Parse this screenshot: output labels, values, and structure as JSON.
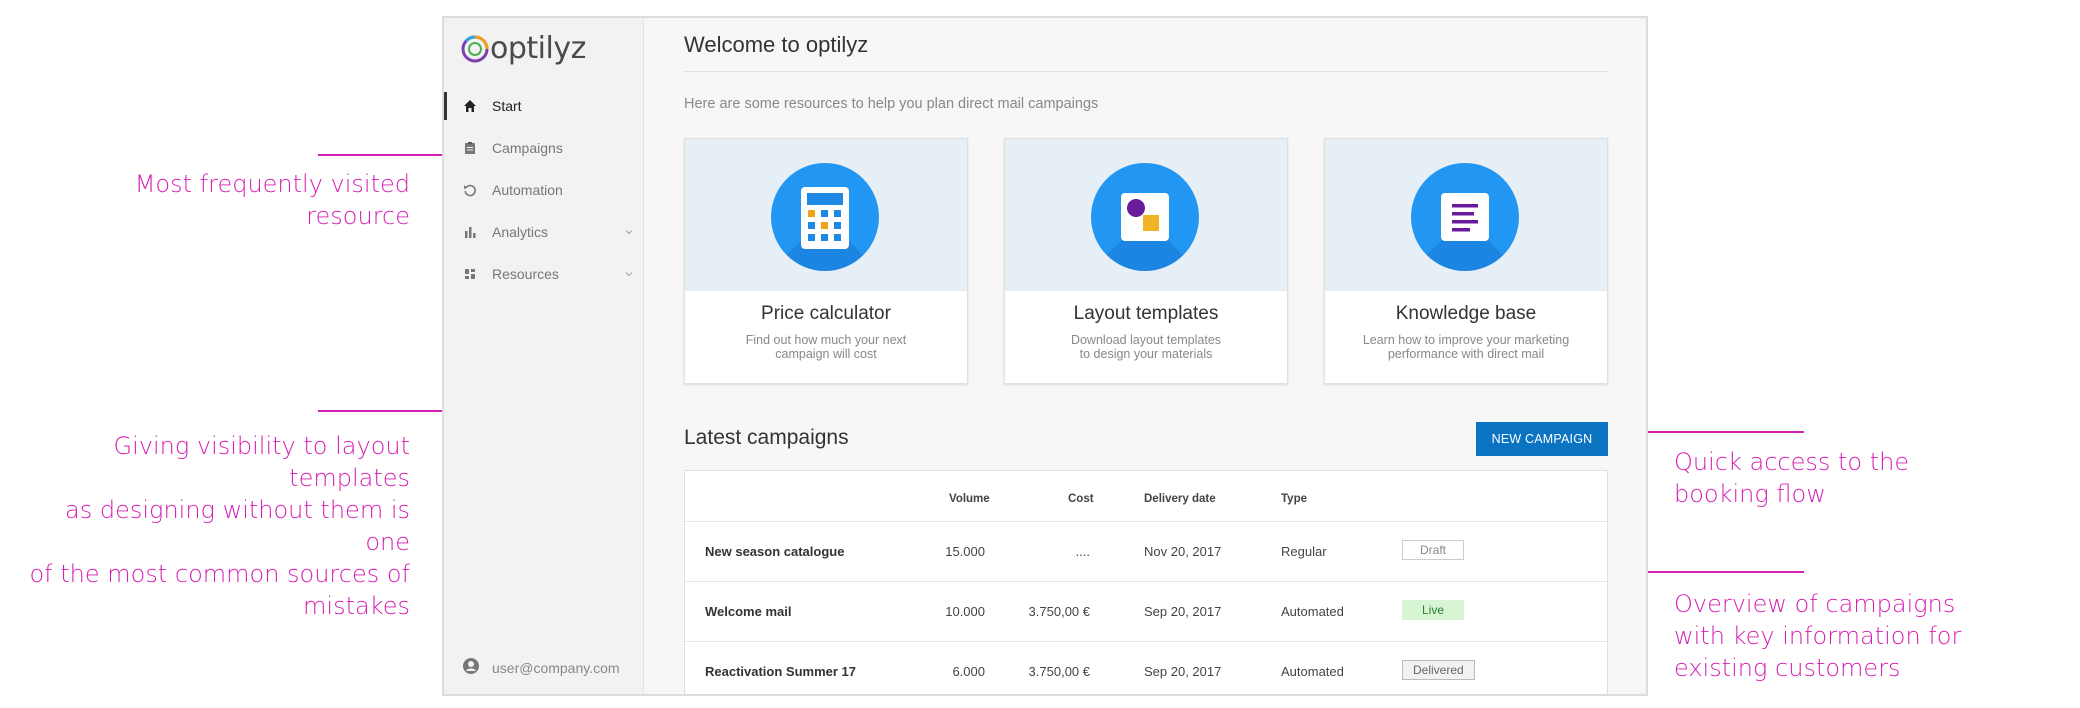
{
  "app": {
    "logo_text": "optilyz"
  },
  "sidebar": {
    "items": [
      {
        "label": "Start",
        "icon": "home-icon"
      },
      {
        "label": "Campaigns",
        "icon": "clipboard-icon"
      },
      {
        "label": "Automation",
        "icon": "refresh-icon"
      },
      {
        "label": "Analytics",
        "icon": "bar-chart-icon"
      },
      {
        "label": "Resources",
        "icon": "dashboard-icon"
      }
    ],
    "user_email": "user@company.com"
  },
  "main": {
    "title": "Welcome to optilyz",
    "intro": "Here are some resources to help you plan direct mail campaings",
    "cards": [
      {
        "title": "Price calculator",
        "desc_line1": "Find out how much your next",
        "desc_line2": "campaign will cost",
        "icon": "calculator-icon"
      },
      {
        "title": "Layout templates",
        "desc_line1": "Download layout templates",
        "desc_line2": "to design your materials",
        "icon": "layout-icon"
      },
      {
        "title": "Knowledge base",
        "desc_line1": "Learn how to improve your marketing",
        "desc_line2": "performance with direct mail",
        "icon": "document-icon"
      }
    ],
    "latest_title": "Latest campaigns",
    "new_campaign_label": "NEW CAMPAIGN",
    "table": {
      "headers": {
        "volume": "Volume",
        "cost": "Cost",
        "delivery": "Delivery date",
        "type": "Type"
      },
      "rows": [
        {
          "name": "New season catalogue",
          "volume": "15.000",
          "cost": "....",
          "delivery": "Nov 20, 2017",
          "type": "Regular",
          "status": "Draft"
        },
        {
          "name": "Welcome mail",
          "volume": "10.000",
          "cost": "3.750,00 €",
          "delivery": "Sep 20, 2017",
          "type": "Automated",
          "status": "Live"
        },
        {
          "name": "Reactivation Summer 17",
          "volume": "6.000",
          "cost": "3.750,00 €",
          "delivery": "Sep 20, 2017",
          "type": "Automated",
          "status": "Delivered"
        }
      ]
    }
  },
  "annotations": {
    "frequent": [
      "Most frequently visited",
      "resource"
    ],
    "layout": [
      "Giving visibility to layout templates",
      "as designing without them is one",
      "of the most common sources of",
      "mistakes"
    ],
    "booking": [
      "Quick access to the",
      "booking flow"
    ],
    "overview": [
      "Overview of campaigns",
      "with key information for",
      "existing customers"
    ]
  },
  "colors": {
    "accent": "#0a73c2",
    "annotation": "#d61fb3",
    "live_badge": "#d7f5d2",
    "card_top": "#e6eef6"
  }
}
